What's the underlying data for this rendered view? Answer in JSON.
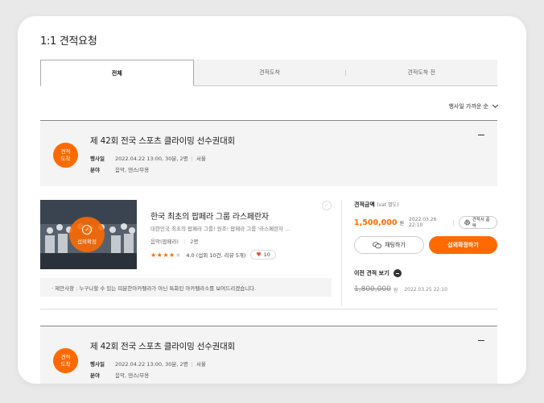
{
  "page_title": "1:1 견적요청",
  "tabs": [
    {
      "label": "전체",
      "active": true
    },
    {
      "label": "견적도착",
      "active": false
    },
    {
      "label": "견적도착 전",
      "active": false
    }
  ],
  "sort": {
    "label": "행사일 가까운 순"
  },
  "events": [
    {
      "badge_line1": "견적",
      "badge_line2": "도착",
      "title": "제 42회 전국 스포츠 클라이밍 선수권대회",
      "date_label": "행사일",
      "date_value": "2022.04.22 13:00, 30분, 2명",
      "location": "서울",
      "field_label": "분야",
      "field_value": "음악, 댄스/무용"
    },
    {
      "badge_line1": "견적",
      "badge_line2": "도착",
      "title": "제 42회 전국 스포츠 클라이밍 선수권대회",
      "date_label": "행사일",
      "date_value": "2022.04.22 13:00, 30분, 2명",
      "location": "서울",
      "field_label": "분야",
      "field_value": "음악, 댄스/무용"
    }
  ],
  "quote": {
    "thumb_seal": "섭외확정",
    "title": "한국 최초의 팝페라 그룹 라스페란자",
    "description": "대한민국 최초의 팝페라 그룹! 원조! 팝페라 그룹 '라스페란자 ...",
    "category": "음악(팝페라)",
    "headcount": "2명",
    "rating_value": 4,
    "rating_text": "4.0 (섭외 10건, 리뷰 5개)",
    "likes": "10",
    "proposal": "· 제안사항 : 누구나할 수 있는 띠분한아카펠라가 아닌 특화된 아카펠라소를 보여드리겠습니다.",
    "amount_label": "견적금액",
    "amount_note": "(vat 별도)",
    "amount": "1,500,000",
    "currency": "원",
    "amount_date": "2022.03.26 22:10",
    "print_button": "견적서 출력",
    "chat_button": "채팅하기",
    "confirm_button": "섭외확정하기",
    "prev_label": "이전 견적 보기",
    "prev_amount": "1,800,000",
    "prev_currency": "원",
    "prev_date": "2022.03.25 22:10"
  },
  "colors": {
    "accent": "#ff6a00",
    "heart": "#e8482d"
  }
}
